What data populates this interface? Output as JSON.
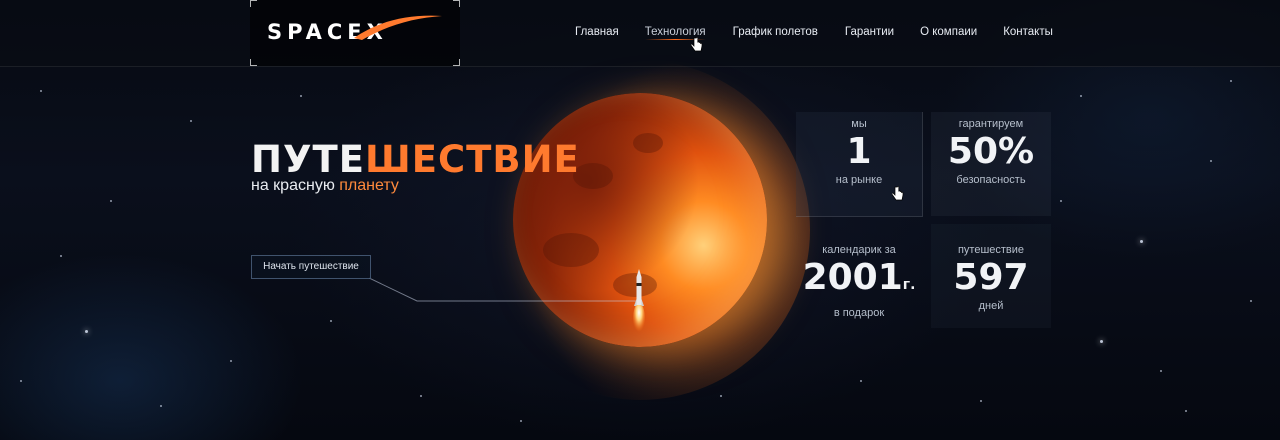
{
  "header": {
    "logo_text": "SPACEX",
    "nav": [
      {
        "label": "Главная"
      },
      {
        "label": "Технология",
        "active": true
      },
      {
        "label": "График полетов"
      },
      {
        "label": "Гарантии"
      },
      {
        "label": "О компаии"
      },
      {
        "label": "Контакты"
      }
    ]
  },
  "hero": {
    "title_white": "ПУТЕ",
    "title_orange": "ШЕСТВИЕ",
    "subtitle_prefix": "на красную ",
    "subtitle_highlight": "планету",
    "cta_label": "Начать путешествие"
  },
  "stats": [
    {
      "caption": "мы",
      "value": "1",
      "sub": "на рынке"
    },
    {
      "caption": "гарантируем",
      "value": "50%",
      "sub": "безопасность"
    },
    {
      "caption": "календарик за",
      "value": "2001",
      "suffix": "г.",
      "sub": "в подарок"
    },
    {
      "caption": "путешествие",
      "value": "597",
      "sub": "дней"
    }
  ],
  "colors": {
    "accent": "#ff7a2e",
    "background": "#04070e"
  }
}
